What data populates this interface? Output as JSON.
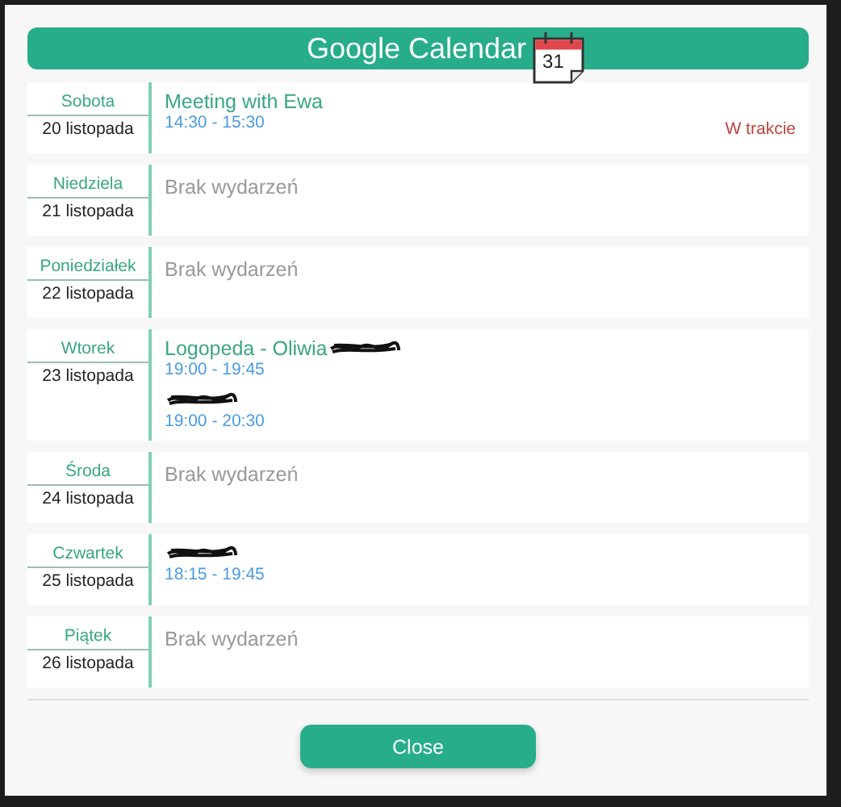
{
  "dialog": {
    "title": "Google Calendar",
    "icon_day": "31"
  },
  "days": [
    {
      "weekday": "Sobota",
      "date": "20 listopada",
      "events": [
        {
          "title": "Meeting with Ewa",
          "time": "14:30 - 15:30",
          "status": "W trakcie"
        }
      ]
    },
    {
      "weekday": "Niedziela",
      "date": "21 listopada",
      "empty_text": "Brak wydarzeń"
    },
    {
      "weekday": "Poniedziałek",
      "date": "22 listopada",
      "empty_text": "Brak wydarzeń"
    },
    {
      "weekday": "Wtorek",
      "date": "23 listopada",
      "events": [
        {
          "title": "Logopeda - Oliwia",
          "redacted": true,
          "time": "19:00 - 19:45"
        },
        {
          "redacted": true,
          "time": "19:00 - 20:30"
        }
      ]
    },
    {
      "weekday": "Środa",
      "date": "24 listopada",
      "empty_text": "Brak wydarzeń"
    },
    {
      "weekday": "Czwartek",
      "date": "25 listopada",
      "events": [
        {
          "redacted": true,
          "time": "18:15 - 19:45"
        }
      ]
    },
    {
      "weekday": "Piątek",
      "date": "26 listopada",
      "empty_text": "Brak wydarzeń"
    }
  ],
  "buttons": [
    {
      "label": "Close"
    }
  ]
}
